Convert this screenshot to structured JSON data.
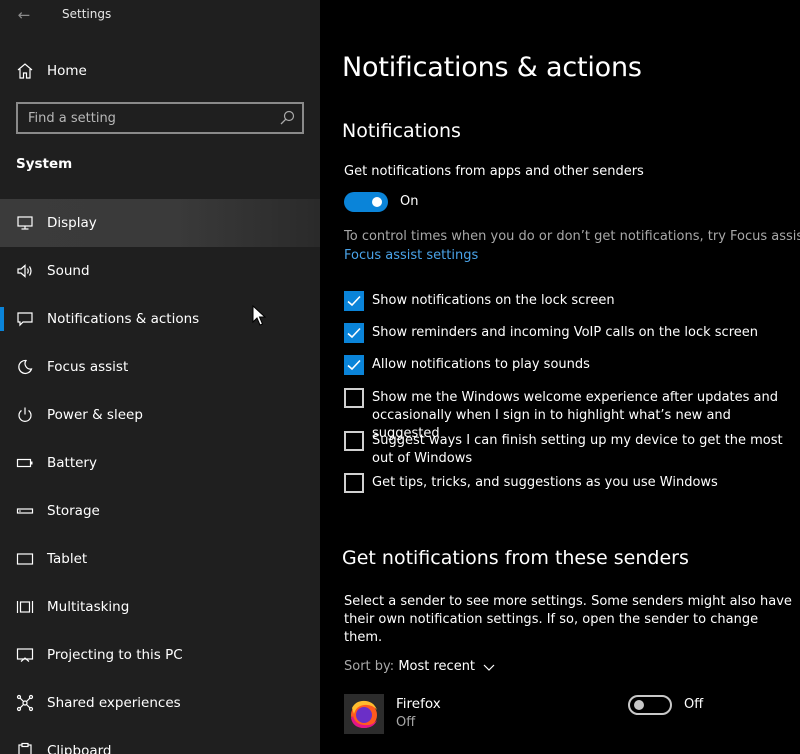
{
  "app": {
    "title": "Settings",
    "back_glyph": "←"
  },
  "sidebar": {
    "home_label": "Home",
    "search_placeholder": "Find a setting",
    "section_title": "System",
    "items": [
      {
        "label": "Display",
        "icon": "monitor-icon"
      },
      {
        "label": "Sound",
        "icon": "speaker-icon"
      },
      {
        "label": "Notifications & actions",
        "icon": "message-icon"
      },
      {
        "label": "Focus assist",
        "icon": "moon-icon"
      },
      {
        "label": "Power & sleep",
        "icon": "power-icon"
      },
      {
        "label": "Battery",
        "icon": "battery-icon"
      },
      {
        "label": "Storage",
        "icon": "storage-icon"
      },
      {
        "label": "Tablet",
        "icon": "tablet-icon"
      },
      {
        "label": "Multitasking",
        "icon": "multitasking-icon"
      },
      {
        "label": "Projecting to this PC",
        "icon": "projector-icon"
      },
      {
        "label": "Shared experiences",
        "icon": "share-icon"
      },
      {
        "label": "Clipboard",
        "icon": "clipboard-icon"
      }
    ]
  },
  "main": {
    "title": "Notifications & actions",
    "notifications_heading": "Notifications",
    "get_notifications_label": "Get notifications from apps and other senders",
    "main_toggle_state": "On",
    "focus_hint": "To control times when you do or don’t get notifications, try Focus assist.",
    "focus_link": "Focus assist settings",
    "checkboxes": [
      {
        "label": "Show notifications on the lock screen",
        "checked": true
      },
      {
        "label": "Show reminders and incoming VoIP calls on the lock screen",
        "checked": true
      },
      {
        "label": "Allow notifications to play sounds",
        "checked": true
      },
      {
        "label": "Show me the Windows welcome experience after updates and occasionally when I sign in to highlight what’s new and suggested",
        "checked": false
      },
      {
        "label": "Suggest ways I can finish setting up my device to get the most out of Windows",
        "checked": false
      },
      {
        "label": "Get tips, tricks, and suggestions as you use Windows",
        "checked": false
      }
    ],
    "senders_heading": "Get notifications from these senders",
    "senders_desc": "Select a sender to see more settings. Some senders might also have their own notification settings. If so, open the sender to change them.",
    "sort_key": "Sort by:",
    "sort_value": "Most recent",
    "senders": [
      {
        "name": "Firefox",
        "status": "Off",
        "toggle": "Off",
        "icon": "firefox-icon"
      }
    ]
  },
  "colors": {
    "accent": "#0a84d9",
    "link": "#4aa3e8",
    "sidebar_bg": "#1f1f1f",
    "main_bg": "#000000"
  }
}
